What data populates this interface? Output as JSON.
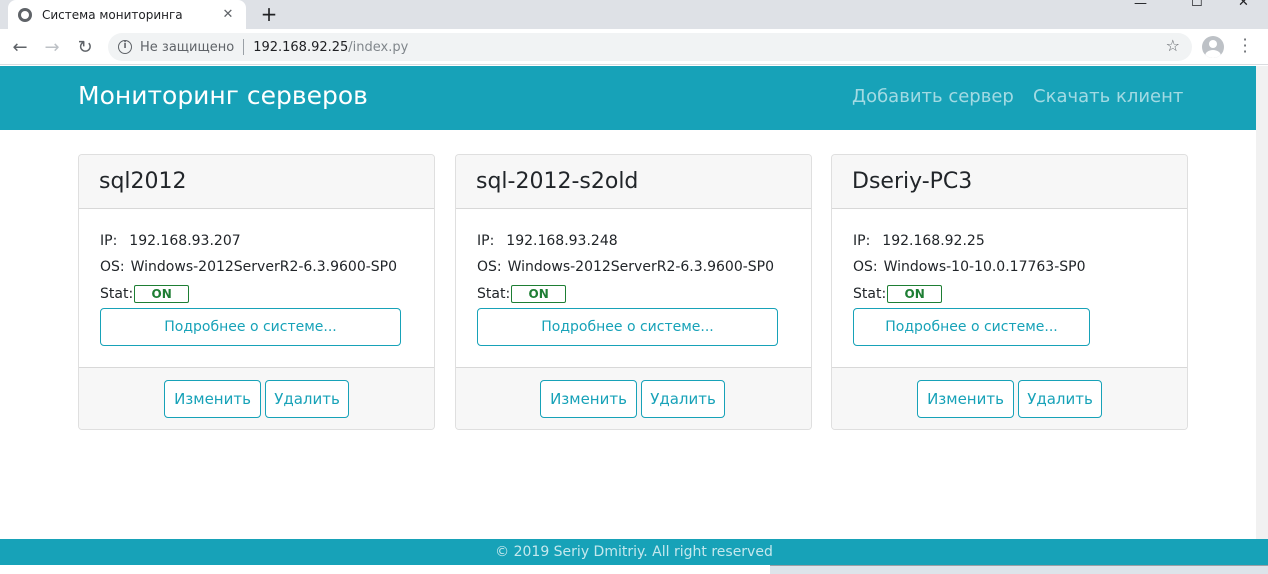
{
  "browser": {
    "tab_title": "Система мониторинга",
    "tab_close": "✕",
    "new_tab": "+",
    "win_minimize": "—",
    "win_maximize": "☐",
    "win_close": "✕",
    "back_icon": "←",
    "forward_icon": "→",
    "reload_icon": "↻",
    "security_label": "Не защищено",
    "url_host": "192.168.92.25",
    "url_path": "/index.py",
    "star_icon": "☆"
  },
  "navbar": {
    "brand": "Мониторинг серверов",
    "links": [
      "Добавить сервер",
      "Скачать клиент"
    ]
  },
  "labels": {
    "ip": "IP:",
    "os": "OS:",
    "stat": "Stat:",
    "details_button": "Подробнее о системе...",
    "edit_button": "Изменить",
    "delete_button": "Удалить"
  },
  "servers": [
    {
      "name": "sql2012",
      "ip": "192.168.93.207",
      "os": "Windows-2012ServerR2-6.3.9600-SP0",
      "status": "ON"
    },
    {
      "name": "sql-2012-s2old",
      "ip": "192.168.93.248",
      "os": "Windows-2012ServerR2-6.3.9600-SP0",
      "status": "ON"
    },
    {
      "name": "Dseriy-PC3",
      "ip": "192.168.92.25",
      "os": "Windows-10-10.0.17763-SP0",
      "status": "ON"
    }
  ],
  "footer": {
    "text": "© 2019 Seriy Dmitriy. All right reserved"
  },
  "colors": {
    "accent": "#17a2b8",
    "status_on": "#1e7e34"
  }
}
